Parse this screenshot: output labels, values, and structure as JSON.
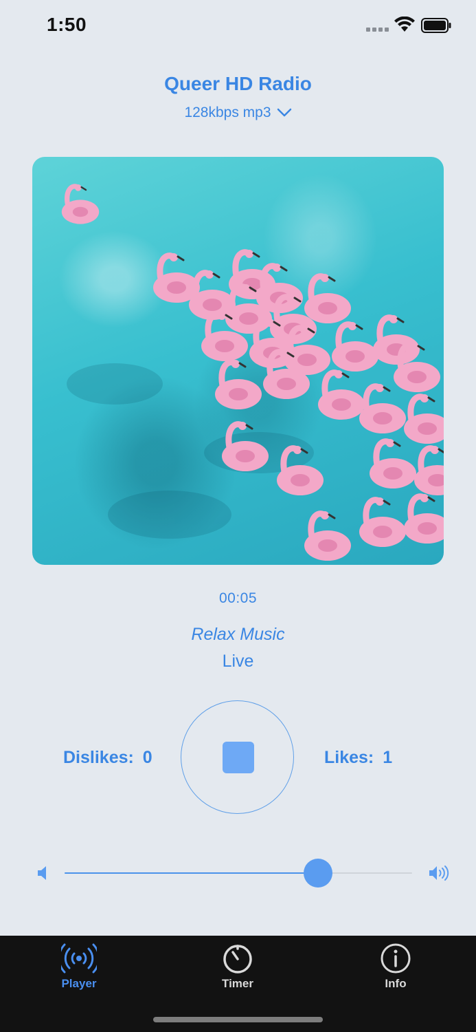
{
  "status_bar": {
    "time": "1:50"
  },
  "header": {
    "station": "Queer HD Radio",
    "bitrate": "128kbps mp3"
  },
  "player": {
    "elapsed": "00:05",
    "track_title": "Relax Music",
    "track_subtitle": "Live",
    "dislikes_label": "Dislikes:",
    "dislikes_count": "0",
    "likes_label": "Likes:",
    "likes_count": "1",
    "state": "playing",
    "volume_fraction": 0.73
  },
  "tabbar": {
    "tabs": [
      {
        "label": "Player",
        "icon": "broadcast-icon",
        "active": true
      },
      {
        "label": "Timer",
        "icon": "timer-icon",
        "active": false
      },
      {
        "label": "Info",
        "icon": "info-icon",
        "active": false
      }
    ]
  },
  "colors": {
    "accent": "#3a86e3",
    "background": "#e4e9ef",
    "tabbar": "#121212",
    "tab_active": "#4a8ff0"
  }
}
